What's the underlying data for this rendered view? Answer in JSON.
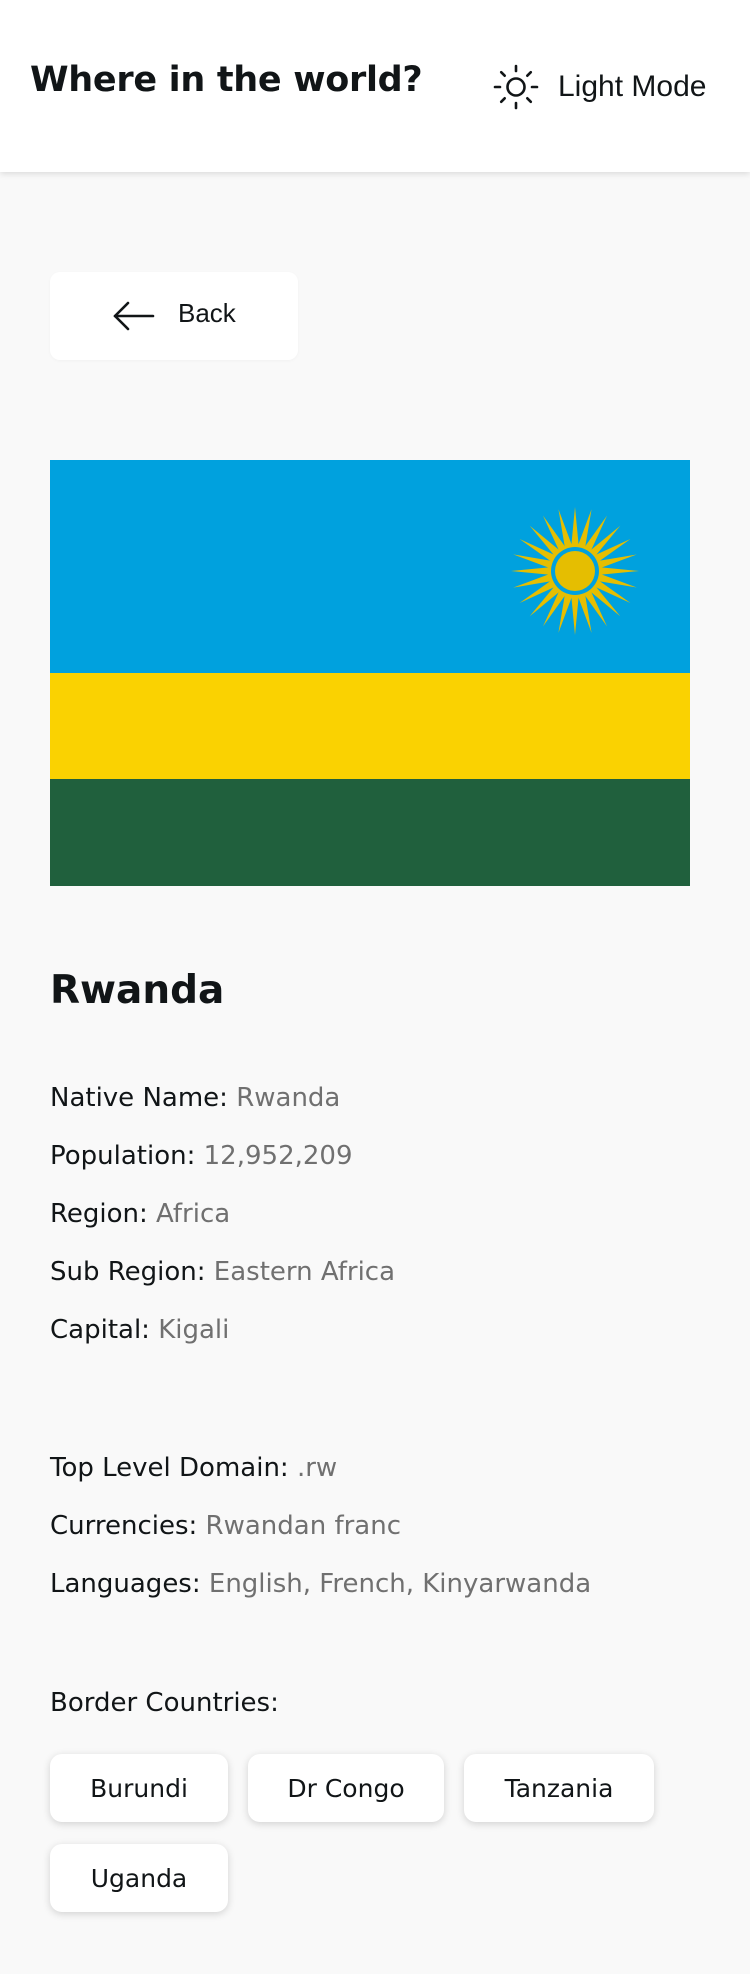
{
  "header": {
    "title": "Where in the world?",
    "mode_icon": "sun-icon",
    "mode_label": "Light Mode"
  },
  "back": {
    "icon": "arrow-left-icon",
    "label": "Back"
  },
  "flag": {
    "icon": "rwanda-flag",
    "colors": {
      "blue": "#00A1DE",
      "yellow": "#FAD201",
      "green": "#20603D",
      "sun": "#E5BE01"
    }
  },
  "country": {
    "name": "Rwanda",
    "native_name": {
      "label": "Native Name:",
      "value": "Rwanda"
    },
    "population": {
      "label": "Population:",
      "value": "12,952,209"
    },
    "region": {
      "label": "Region:",
      "value": "Africa"
    },
    "sub_region": {
      "label": "Sub Region:",
      "value": "Eastern Africa"
    },
    "capital": {
      "label": "Capital:",
      "value": "Kigali"
    },
    "top_level_domain": {
      "label": "Top Level Domain:",
      "value": ".rw"
    },
    "currencies": {
      "label": "Currencies:",
      "value": "Rwandan franc"
    },
    "languages": {
      "label": "Languages:",
      "value": "English, French, Kinyarwanda"
    }
  },
  "border_countries": {
    "label": "Border Countries:",
    "items": [
      "Burundi",
      "Dr Congo",
      "Tanzania",
      "Uganda"
    ]
  },
  "theme": {
    "background": "#F9F9F9",
    "text": "#111517",
    "value_text": "#707070",
    "surface": "#FFFFFF"
  }
}
